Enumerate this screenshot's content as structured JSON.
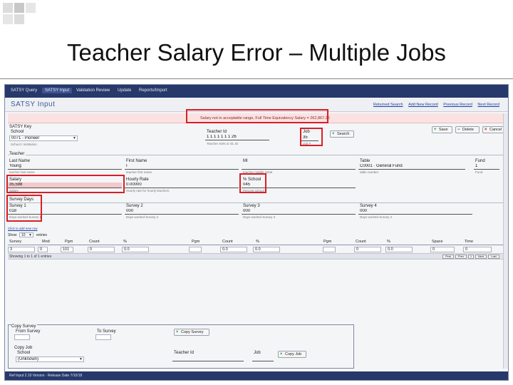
{
  "slide": {
    "title": "Teacher Salary Error – Multiple Jobs"
  },
  "nav": {
    "items": [
      "SATSY Query",
      "SATSY Input",
      "Validation Review",
      "Update",
      "Reports/Import"
    ],
    "active_index": 1
  },
  "header": {
    "title": "SATSY Input",
    "links": [
      "Returned Search",
      "Add New Record",
      "Previous Record",
      "Next Record"
    ]
  },
  "error": {
    "text": "Salary not in acceptable range, Full Time Equivalency Salary = 262,867.26"
  },
  "key": {
    "section": "SATSY Key",
    "school_label": "School",
    "school_value": "0071 - Pioneer",
    "school_help": "School / Institution",
    "teacher_id_label": "Teacher Id",
    "teacher_id_value": "1 1 1 1 1 1 1 26",
    "teacher_id_help": "Teacher SSN or DL ID",
    "job_label": "Job",
    "job_value": "35",
    "job_help": "Job #"
  },
  "buttons": {
    "search": "Search",
    "save": "Save",
    "delete": "Delete",
    "cancel": "Cancel",
    "copy_survey": "Copy Survey",
    "copy_job": "Copy Job"
  },
  "teacher": {
    "section": "Teacher",
    "last_name_label": "Last Name",
    "last_name_value": "Young",
    "last_name_help": "teacher last name",
    "first_name_label": "First Name",
    "first_name_value": "I",
    "first_name_help": "teacher first name",
    "mi_label": "MI",
    "mi_value": "",
    "mi_help": "teacher middle initial",
    "table_label": "Table",
    "table_value": "C0001 · General Fund",
    "table_help": "table number",
    "fund_label": "Fund",
    "fund_value": "1",
    "fund_help": "Fund",
    "salary_label": "Salary",
    "salary_value": "35,598",
    "salary_help": "Salary",
    "hourly_rate_label": "Hourly Rate",
    "hourly_rate_value": "0.00000",
    "hourly_rate_help": "Hourly rate for hourly teachers",
    "pct_school_label": "% School",
    "pct_school_value": "045",
    "pct_school_help": "Percent school"
  },
  "survey_days": {
    "section": "Survey Days",
    "fields": [
      {
        "label": "Survey 1",
        "value": "018",
        "help": "Days worked Survey 1"
      },
      {
        "label": "Survey 2",
        "value": "000",
        "help": "Days worked Survey 2"
      },
      {
        "label": "Survey 3",
        "value": "000",
        "help": "Days worked Survey 3"
      },
      {
        "label": "Survey 4",
        "value": "000",
        "help": "Days worked Survey 4"
      }
    ]
  },
  "grid": {
    "add_link": "Click to add new row",
    "show_label": "Show",
    "show_value": "10",
    "entries_label": "entries",
    "columns": [
      "Survey",
      "Mod",
      "Pgm",
      "Count",
      "%",
      "Pgm",
      "Count",
      "%",
      "Pgm",
      "Count",
      "%",
      "Space",
      "Time"
    ],
    "row": [
      "3",
      "0",
      "101",
      "0",
      "0.0",
      "",
      "0.0",
      "0.0",
      "",
      "0",
      "0.0",
      "0",
      "0"
    ],
    "status": "Showing 1 to 1 of 1 entries",
    "pager": [
      "First",
      "Prev",
      "1",
      "Next",
      "Last"
    ]
  },
  "copy_survey": {
    "section": "Copy Survey",
    "from_label": "From Survey",
    "to_label": "To Survey"
  },
  "copy_job": {
    "section": "Copy Job",
    "school_label": "School",
    "school_value": "(Unknown)",
    "teacher_id_label": "Teacher Id",
    "job_label": "Job"
  },
  "footer": {
    "text": "Ref Input 2.10 Version · Release Date 7/10/18"
  },
  "colors": {
    "nav_bg": "#27386a",
    "error_bg": "#fbe2e2",
    "highlight": "#d81f26",
    "salary_field_bg": "#f3c9cb"
  }
}
